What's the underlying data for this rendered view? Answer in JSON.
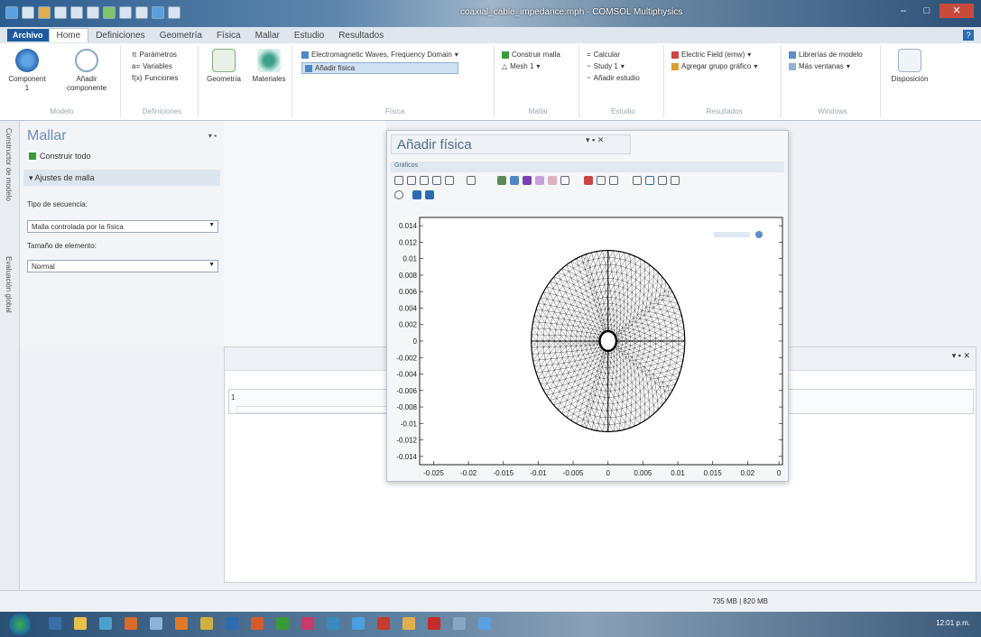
{
  "window": {
    "title": "coaxial_cable_impedance.mph - COMSOL Multiphysics"
  },
  "ribbon": {
    "file_tab": "Archivo",
    "tabs": [
      "Home",
      "Definiciones",
      "Geometría",
      "Física",
      "Mallar",
      "Estudio",
      "Resultados"
    ],
    "groups": {
      "modelo": {
        "label": "Modelo",
        "component": "Component 1",
        "add_component": "Añadir componente"
      },
      "definiciones": {
        "label": "Definiciones",
        "items": [
          "Parámetros",
          "Variables",
          "Funciones"
        ]
      },
      "geom": {
        "geometry": "Geometría",
        "materials": "Materiales"
      },
      "fisica": {
        "label": "Física",
        "physics": "Electromagnetic Waves, Frequency Domain",
        "add_physics": "Añadir física"
      },
      "mallar": {
        "label": "Mallar",
        "build": "Construir malla",
        "mesh": "Mesh 1"
      },
      "estudio": {
        "label": "Estudio",
        "compute": "Calcular",
        "study": "Study 1",
        "add_study": "Añadir estudio"
      },
      "resultados": {
        "label": "Resultados",
        "field": "Electric Field (emw)",
        "add_group": "Agregar grupo gráfico"
      },
      "windows": {
        "label": "Windows",
        "libraries": "Librerías de modelo",
        "more_windows": "Más ventanas"
      },
      "layout": {
        "label": "Disposición"
      }
    }
  },
  "left_strip": {
    "model_builder": "Constructor de modelo",
    "global_eval": "Evaluación global"
  },
  "settings": {
    "title": "Mallar",
    "build_all": "Construir todo",
    "section": "Ajustes de malla",
    "sequence_label": "Tipo de secuencia:",
    "sequence_value": "Malla controlada por la física",
    "size_label": "Tamaño de elemento:",
    "size_value": "Normal"
  },
  "add_physics_window": {
    "title": "Añadir física",
    "graphics_label": "Gráficos"
  },
  "chart_data": {
    "type": "scatter",
    "title": "",
    "xlabel": "",
    "ylabel": "",
    "x_ticks": [
      "-0.025",
      "-0.02",
      "-0.015",
      "-0.01",
      "-0.005",
      "0",
      "0.005",
      "0.01",
      "0.015",
      "0.02",
      "0"
    ],
    "y_ticks": [
      "0.014",
      "0.012",
      "0.01",
      "0.008",
      "0.006",
      "0.004",
      "0.002",
      "0",
      "-0.002",
      "-0.004",
      "-0.006",
      "-0.008",
      "-0.01",
      "-0.012",
      "-0.014"
    ],
    "xlim": [
      -0.027,
      0.025
    ],
    "ylim": [
      -0.015,
      0.015
    ],
    "geometry": {
      "outer_radius": 0.011,
      "inner_radius": 0.0012,
      "center": [
        0,
        0
      ]
    },
    "grid": false,
    "legend": "none"
  },
  "status": {
    "memory": "735 MB | 820 MB"
  },
  "taskbar": {
    "clock": "12:01 p.m."
  },
  "colors": {
    "accent": "#1f5a9e",
    "title_text": "#6b8fb8",
    "mesh_line": "#111111"
  }
}
